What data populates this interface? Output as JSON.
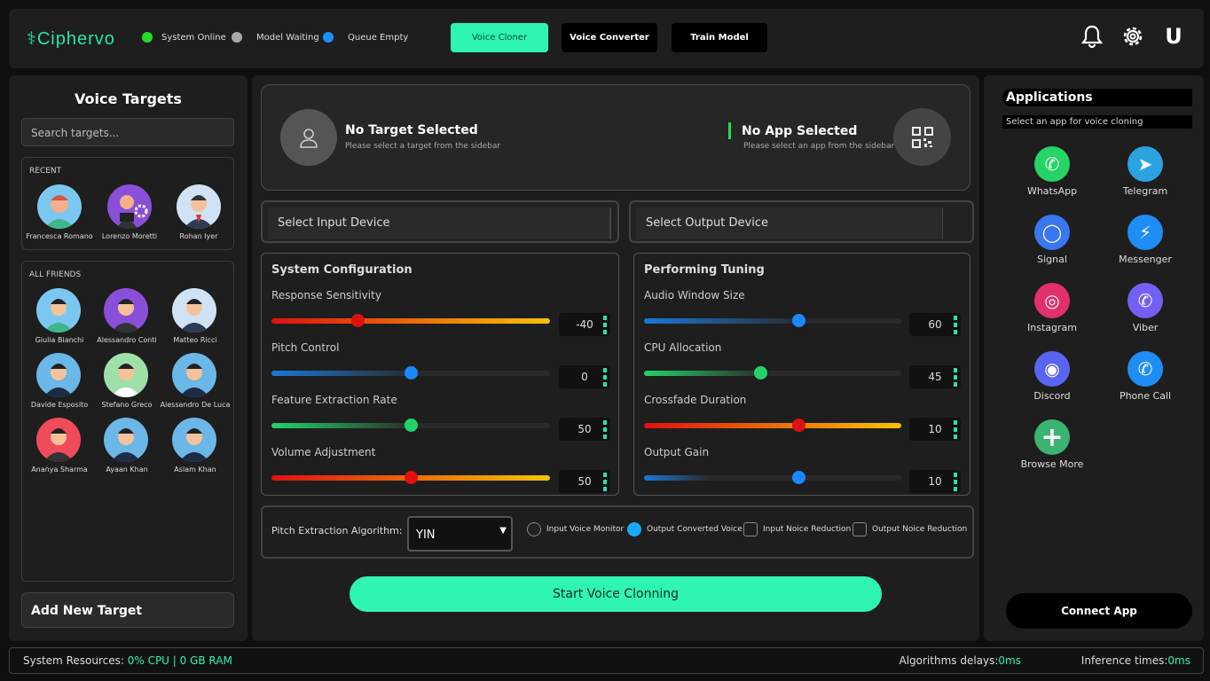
{
  "app": {
    "logo": "Ciphervo"
  },
  "status": [
    {
      "label": "System Online",
      "color": "#22dd22"
    },
    {
      "label": "Model Waiting",
      "color": "#aaaaaa"
    },
    {
      "label": "Queue Empty",
      "color": "#1e90ff"
    }
  ],
  "nav": {
    "voice_cloner": "Voice Cloner",
    "voice_converter": "Voice Converter",
    "train_model": "Train Model"
  },
  "top_icons": {
    "bell": "bell-icon",
    "settings": "gear-icon",
    "user_initial": "U"
  },
  "sidebar": {
    "title": "Voice Targets",
    "search_placeholder": "Search targets...",
    "recent_label": "RECENT",
    "recent": [
      {
        "name": "Francesca Romano"
      },
      {
        "name": "Lorenzo Moretti"
      },
      {
        "name": "Rohan Iyer"
      }
    ],
    "friends_label": "ALL FRIENDS",
    "friends": [
      {
        "name": "Giulia Bianchi"
      },
      {
        "name": "Alessandro Conti"
      },
      {
        "name": "Matteo Ricci"
      },
      {
        "name": "Davide Esposito"
      },
      {
        "name": "Stefano Greco"
      },
      {
        "name": "Alessandro De Luca"
      },
      {
        "name": "Ananya Sharma"
      },
      {
        "name": "Ayaan Khan"
      },
      {
        "name": "Aslam Khan"
      }
    ],
    "add_target": "Add New Target"
  },
  "target_card": {
    "target_title": "No Target Selected",
    "target_sub": "Please select a target from the sidebar",
    "app_title": "No App Selected",
    "app_sub": "Please select an app from the sidebar"
  },
  "devices": {
    "input": "Select Input Device",
    "output": "Select Output Device"
  },
  "system_config": {
    "title": "System Configuration",
    "sliders": [
      {
        "label": "Response Sensitivity",
        "value": "-40",
        "fraction": 0.31
      },
      {
        "label": "Pitch Control",
        "value": "0",
        "fraction": 0.5
      },
      {
        "label": "Feature Extraction Rate",
        "value": "50",
        "fraction": 0.5
      },
      {
        "label": "Volume Adjustment",
        "value": "50",
        "fraction": 0.5
      }
    ]
  },
  "perf_tuning": {
    "title": "Performing Tuning",
    "sliders": [
      {
        "label": "Audio Window Size",
        "value": "60",
        "fraction": 0.6
      },
      {
        "label": "CPU Allocation",
        "value": "45",
        "fraction": 0.45
      },
      {
        "label": "Crossfade Duration",
        "value": "10",
        "fraction": 0.6
      },
      {
        "label": "Output Gain",
        "value": "10",
        "fraction": 0.6
      }
    ]
  },
  "algorithm": {
    "label": "Pitch Extraction Algorithm:",
    "selected": "YIN",
    "options": [
      {
        "label": "Input Voice Monitor",
        "checked": false
      },
      {
        "label": "Output Converted Voice",
        "checked": true
      },
      {
        "label": "Input Noice Reduction",
        "checked": false
      },
      {
        "label": "Output Noice Reduction",
        "checked": false
      }
    ]
  },
  "start_button": "Start Voice Clonning",
  "apps_panel": {
    "title": "Applications",
    "subtitle": "Select an app for voice cloning",
    "apps": [
      {
        "name": "WhatsApp",
        "color": "#25d366",
        "icon": "whatsapp-icon"
      },
      {
        "name": "Telegram",
        "color": "#2aa3e0",
        "icon": "telegram-icon"
      },
      {
        "name": "Signal",
        "color": "#3a76f0",
        "icon": "signal-icon"
      },
      {
        "name": "Messenger",
        "color": "#1e8ef5",
        "icon": "messenger-icon"
      },
      {
        "name": "Instagram",
        "color": "#e1306c",
        "icon": "instagram-icon"
      },
      {
        "name": "Viber",
        "color": "#7360f2",
        "icon": "viber-icon"
      },
      {
        "name": "Discord",
        "color": "#5865f2",
        "icon": "discord-icon"
      },
      {
        "name": "Phone Call",
        "color": "#1e8ef5",
        "icon": "phone-icon"
      },
      {
        "name": "Browse More",
        "color": "#3cb371",
        "icon": "plus-icon"
      }
    ],
    "connect": "Connect App"
  },
  "footer": {
    "resources_label": "System Resources:",
    "resources_value": "0% CPU | 0 GB RAM",
    "delay_label": "Algorithms delays:",
    "delay_value": "0ms",
    "inference_label": "Inference times:",
    "inference_value": "0ms"
  }
}
